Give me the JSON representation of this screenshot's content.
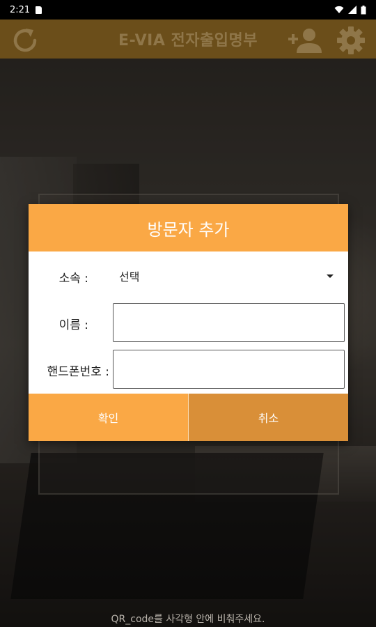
{
  "status_bar": {
    "time": "2:21"
  },
  "app_bar": {
    "title": "E-VIA 전자출입명부",
    "icons": [
      "refresh-icon",
      "add-user-icon",
      "settings-icon"
    ]
  },
  "dialog": {
    "title": "방문자 추가",
    "org_label": "소속 :",
    "org_value": "선택",
    "name_label": "이름 :",
    "name_value": "",
    "phone_label": "핸드폰번호 :",
    "phone_value": "",
    "confirm_label": "확인",
    "cancel_label": "취소"
  },
  "hint_text": "QR_code를 사각형 안에 비춰주세요.",
  "colors": {
    "app_bar": "#6b4e1a",
    "dialog_accent": "#faa845",
    "cancel_button": "#d98f38"
  }
}
